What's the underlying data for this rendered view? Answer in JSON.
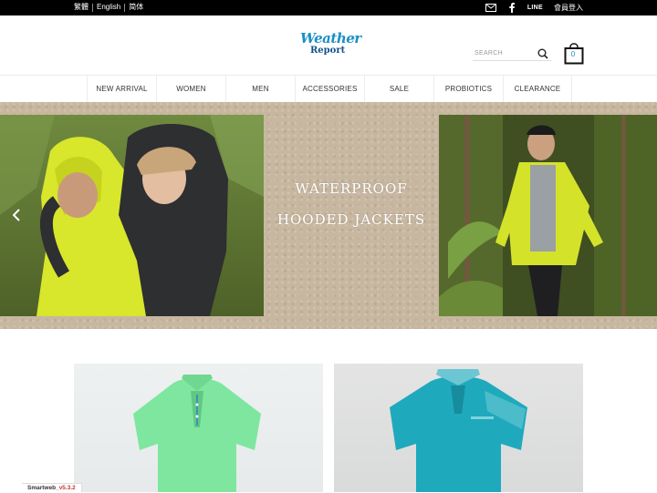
{
  "topbar": {
    "languages": [
      "繁體",
      "English",
      "简体"
    ],
    "line_label": "LINE",
    "login_label": "會員登入",
    "icons": [
      "mail-icon",
      "facebook-icon"
    ]
  },
  "header": {
    "logo_line1": "Weather",
    "logo_line2": "Report",
    "logo_reg": "®",
    "search_placeholder": "SEARCH",
    "cart_count": "0"
  },
  "nav": {
    "items": [
      "NEW ARRIVAL",
      "WOMEN",
      "MEN",
      "ACCESSORIES",
      "SALE",
      "PROBIOTICS",
      "CLEARANCE"
    ]
  },
  "banner": {
    "line1": "WATERPROOF",
    "line2": "HOODED JACKETS"
  },
  "products": {
    "colors": [
      "#7fe6a0",
      "#1fa9bd"
    ]
  },
  "footer": {
    "badge_name": "Smartweb",
    "badge_version": "_v5.3.2"
  },
  "colors": {
    "brand_blue": "#1a8fc4",
    "brand_dark": "#14508c",
    "topbar": "#000000",
    "jacket_yellow": "#d4e32a"
  }
}
